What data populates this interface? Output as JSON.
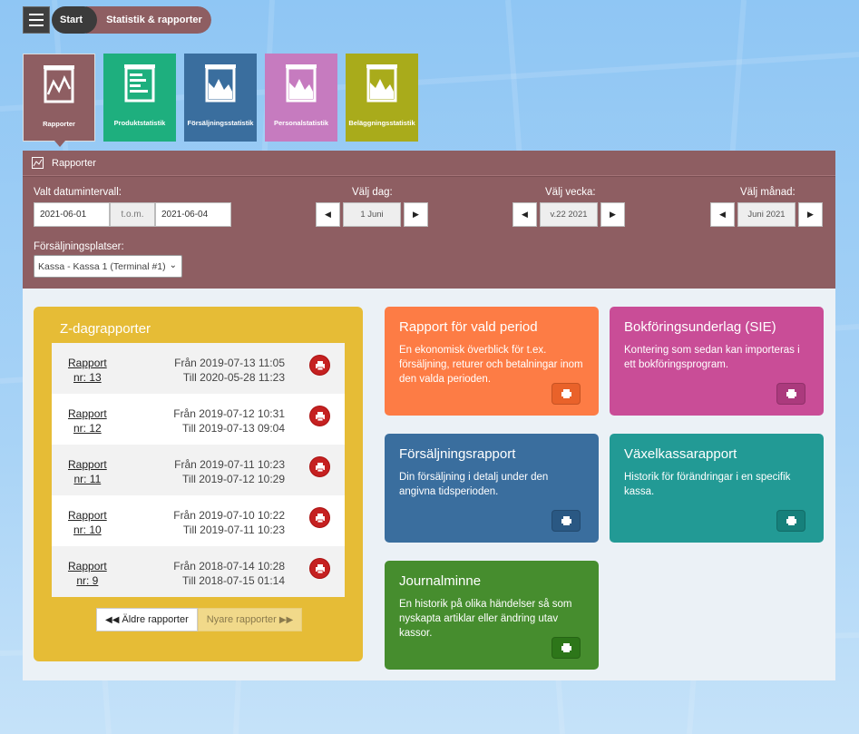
{
  "breadcrumb": {
    "start": "Start",
    "current": "Statistik & rapporter"
  },
  "tiles": [
    {
      "label": "Rapporter",
      "icon": "line-chart-icon",
      "color": "#8e5e62"
    },
    {
      "label": "Produktstatistik",
      "icon": "bar-list-icon",
      "color": "#1eaf7e"
    },
    {
      "label": "Försäljningsstatistik",
      "icon": "area-chart-icon",
      "color": "#3a6e9e"
    },
    {
      "label": "Personalstatistik",
      "icon": "area-chart-icon",
      "color": "#c67bbf"
    },
    {
      "label": "Beläggningsstatistik",
      "icon": "area-chart-icon",
      "color": "#a9ab1b"
    }
  ],
  "panel": {
    "title": "Rapporter"
  },
  "filters": {
    "date_range_label": "Valt datumintervall:",
    "date_from": "2021-06-01",
    "date_to_sep": "t.o.m.",
    "date_to": "2021-06-04",
    "day_label": "Välj dag:",
    "day_value": "1 Juni",
    "week_label": "Välj vecka:",
    "week_value": "v.22 2021",
    "month_label": "Välj månad:",
    "month_value": "Juni 2021",
    "location_label": "Försäljningsplatser:",
    "location_value": "Kassa - Kassa 1 (Terminal #1)"
  },
  "zdag": {
    "title": "Z-dagrapporter",
    "rows": [
      {
        "line1": "Rapport",
        "line2": "nr: 13",
        "from": "Från 2019-07-13 11:05",
        "to": "Till 2020-05-28 11:23"
      },
      {
        "line1": "Rapport",
        "line2": "nr: 12",
        "from": "Från 2019-07-12 10:31",
        "to": "Till 2019-07-13 09:04"
      },
      {
        "line1": "Rapport",
        "line2": "nr: 11",
        "from": "Från 2019-07-11 10:23",
        "to": "Till 2019-07-12 10:29"
      },
      {
        "line1": "Rapport",
        "line2": "nr: 10",
        "from": "Från 2019-07-10 10:22",
        "to": "Till 2019-07-11 10:23"
      },
      {
        "line1": "Rapport",
        "line2": "nr: 9",
        "from": "Från 2018-07-14 10:28",
        "to": "Till 2018-07-15 01:14"
      }
    ],
    "older": "Äldre rapporter",
    "newer": "Nyare rapporter"
  },
  "cards": [
    {
      "title": "Rapport för vald period",
      "desc": "En ekonomisk överblick för t.ex. försäljning, returer och betalningar inom den valda perioden.",
      "color": "#fd7c45"
    },
    {
      "title": "Bokföringsunderlag (SIE)",
      "desc": "Kontering som sedan kan importeras i ett bokföringsprogram.",
      "color": "#c94d97"
    },
    {
      "title": "Försäljningsrapport",
      "desc": "Din försäljning i detalj under den angivna tidsperioden.",
      "color": "#3a6e9e"
    },
    {
      "title": "Växelkassarapport",
      "desc": "Historik för förändringar i en specifik kassa.",
      "color": "#229a95"
    },
    {
      "title": "Journalminne",
      "desc": "En historik på olika händelser så som nyskapta artiklar eller ändring utav kassor.",
      "color": "#468d2e"
    }
  ]
}
